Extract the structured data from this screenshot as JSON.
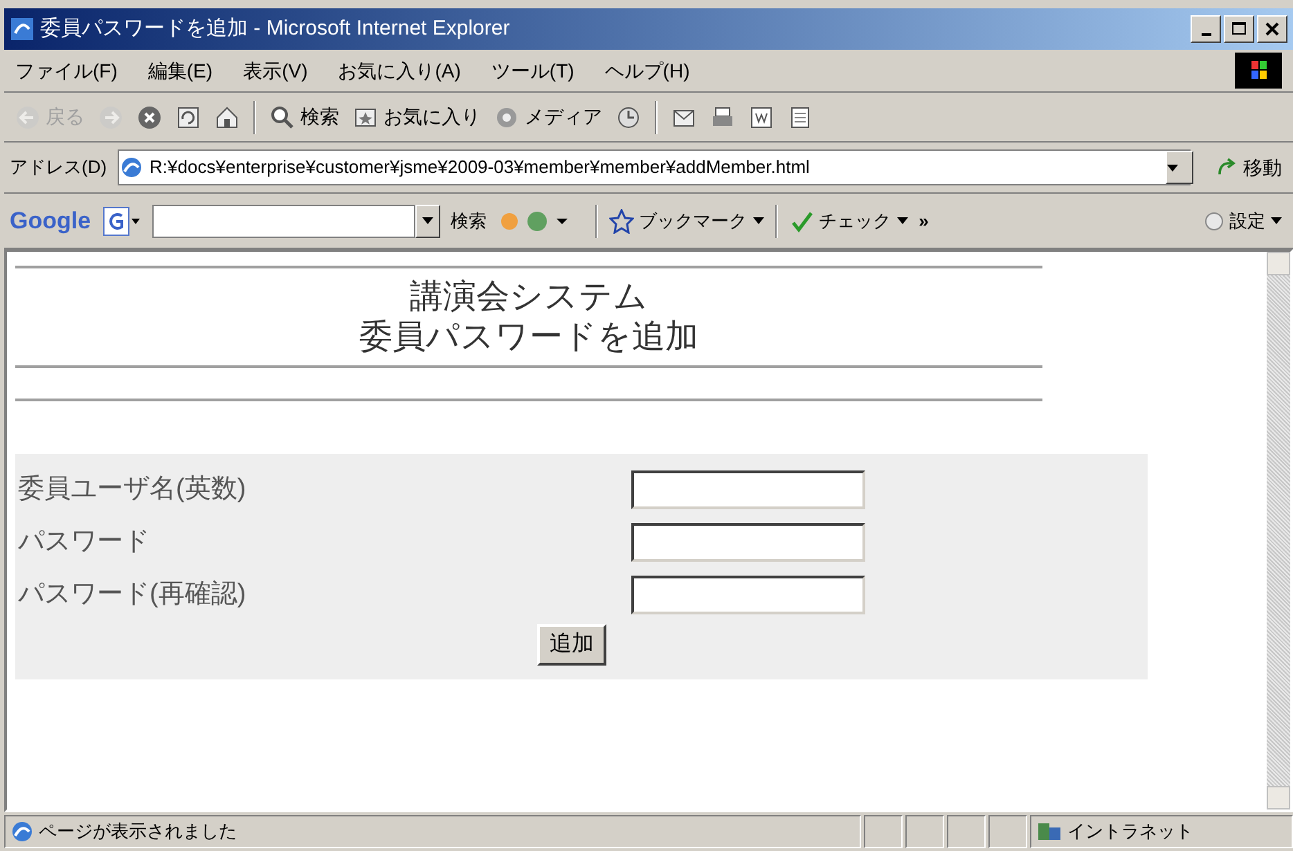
{
  "window": {
    "title": "委員パスワードを追加 - Microsoft Internet Explorer"
  },
  "menu": [
    "ファイル(F)",
    "編集(E)",
    "表示(V)",
    "お気に入り(A)",
    "ツール(T)",
    "ヘルプ(H)"
  ],
  "toolbar": [
    {
      "kind": "back",
      "label": "戻る",
      "disabled": true
    },
    {
      "kind": "forward",
      "disabled": true
    },
    {
      "kind": "stop"
    },
    {
      "kind": "refresh"
    },
    {
      "kind": "home"
    },
    {
      "kind": "sep"
    },
    {
      "kind": "search",
      "label": "検索"
    },
    {
      "kind": "favorites",
      "label": "お気に入り"
    },
    {
      "kind": "media",
      "label": "メディア"
    },
    {
      "kind": "history"
    },
    {
      "kind": "sep"
    },
    {
      "kind": "mail"
    },
    {
      "kind": "print"
    },
    {
      "kind": "edit"
    },
    {
      "kind": "discuss"
    }
  ],
  "address": {
    "label": "アドレス(D)",
    "value": "R:¥docs¥enterprise¥customer¥jsme¥2009-03¥member¥member¥addMember.html",
    "go": "移動"
  },
  "google_bar": {
    "logo": "Google",
    "search_label": "検索",
    "bookmarks": "ブックマーク",
    "check": "チェック",
    "more": "»",
    "settings": "設定"
  },
  "page": {
    "heading": [
      "講演会システム",
      "委員パスワードを追加"
    ],
    "fields": [
      {
        "label": "委員ユーザ名(英数)"
      },
      {
        "label": "パスワード"
      },
      {
        "label": "パスワード(再確認)"
      }
    ],
    "submit": "追加"
  },
  "status_bar": {
    "message": "ページが表示されました",
    "zone": "イントラネット"
  }
}
